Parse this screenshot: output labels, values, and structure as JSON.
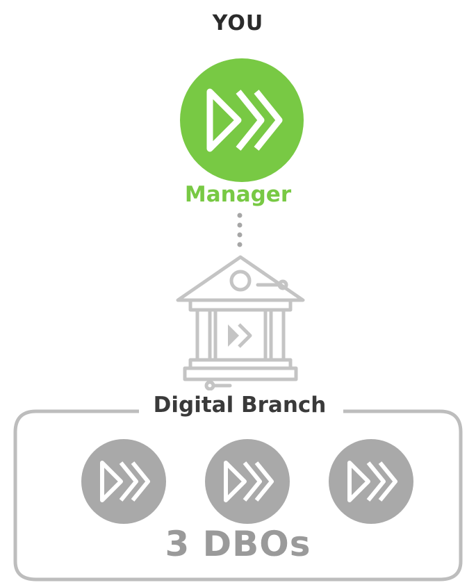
{
  "top_label": "YOU",
  "manager": {
    "label": "Manager",
    "color": "#78c944"
  },
  "branch": {
    "icon": "bank-building-icon",
    "title": "Digital Branch",
    "members_label": "3 DBOs",
    "member_count": 3,
    "member_color": "#a9a9a9"
  }
}
